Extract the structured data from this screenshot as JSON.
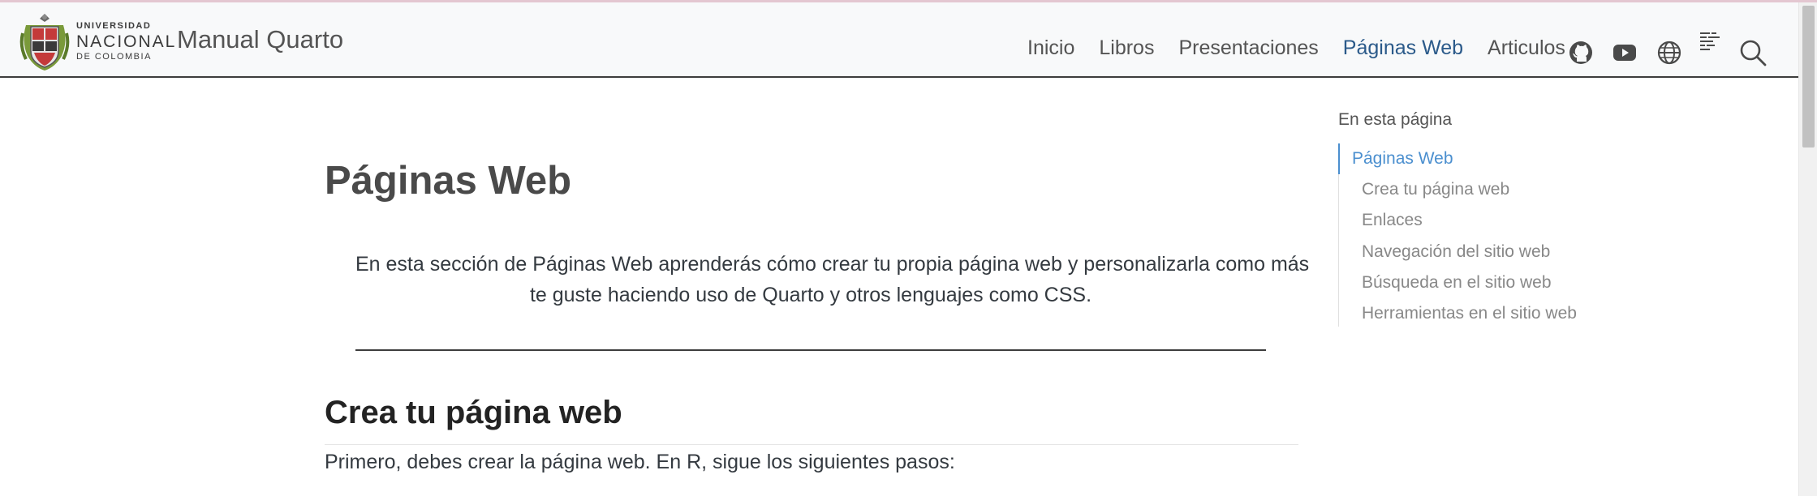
{
  "brand": {
    "logo_line1": "UNIVERSIDAD",
    "logo_line2": "NACIONAL",
    "logo_line3": "DE COLOMBIA",
    "site_title": "Manual Quarto"
  },
  "nav": {
    "links": [
      "Inicio",
      "Libros",
      "Presentaciones",
      "Páginas Web",
      "Articulos"
    ],
    "active": "Páginas Web",
    "icons": [
      "github-icon",
      "youtube-icon",
      "globe-icon",
      "list-icon",
      "search-icon"
    ],
    "accent_color": "#2b5a8a"
  },
  "main": {
    "title": "Páginas Web",
    "intro_line1": "En esta sección de Páginas Web aprenderás cómo crear tu propia página web y personalizarla como más",
    "intro_line2": "te guste haciendo uso de Quarto y otros lenguajes como CSS.",
    "section_heading": "Crea tu página web",
    "section_para": "Primero, debes crear la página web. En R, sigue los siguientes pasos:"
  },
  "toc": {
    "title": "En esta página",
    "items": [
      "Páginas Web",
      "Crea tu página web",
      "Enlaces",
      "Navegación del sitio web",
      "Búsqueda en el sitio web",
      "Herramientas en el sitio web"
    ],
    "active_color": "#4b8fcf"
  }
}
